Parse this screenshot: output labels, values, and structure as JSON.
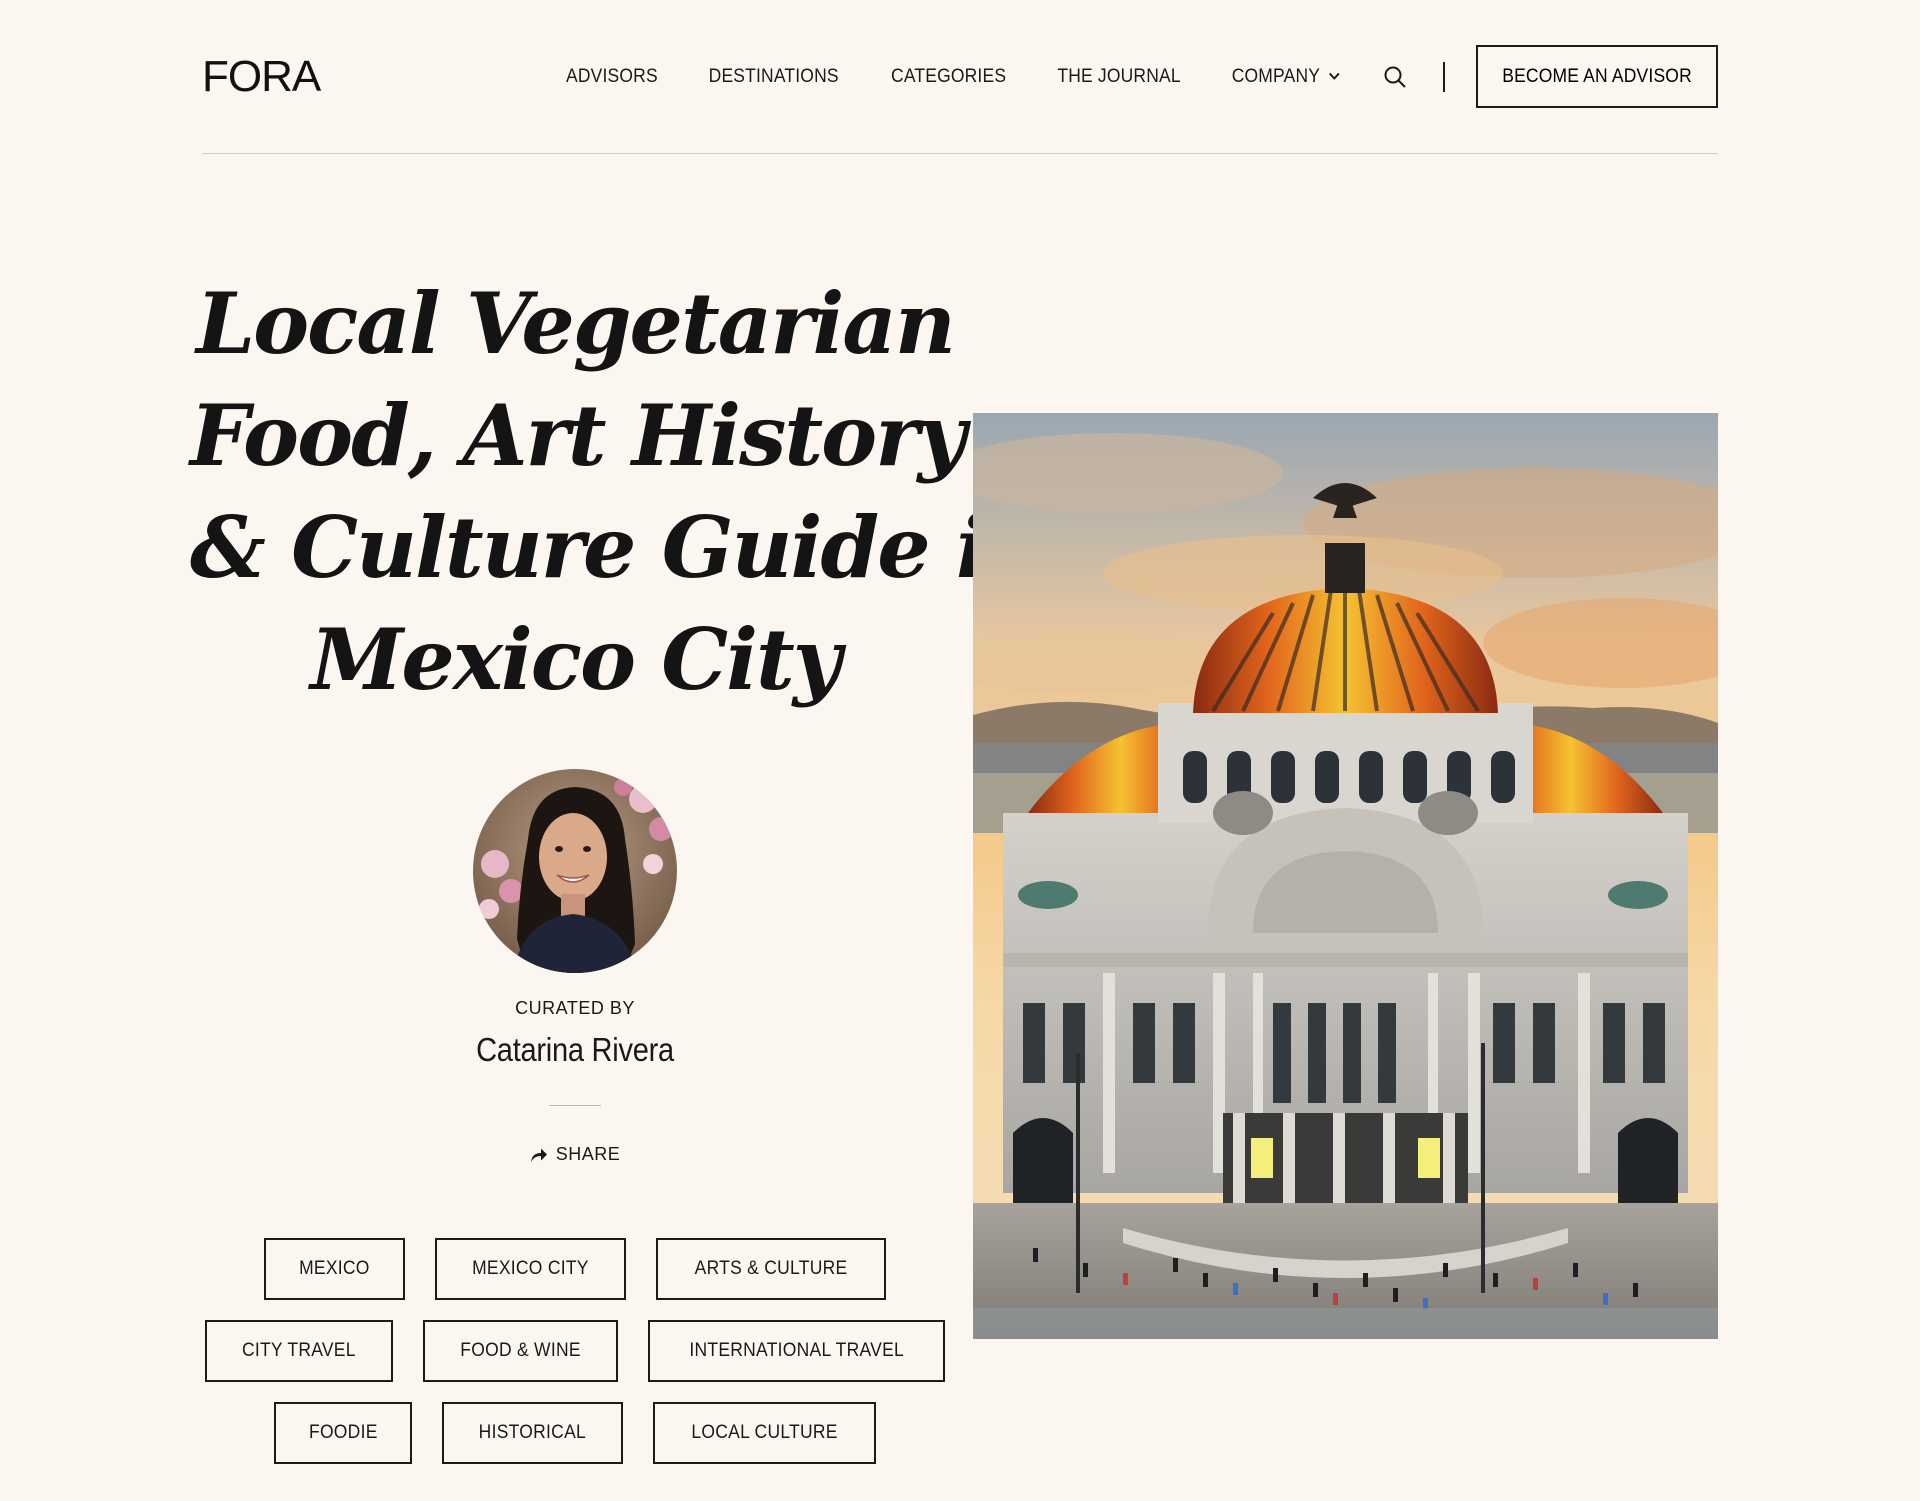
{
  "brand": {
    "logo": "FORA"
  },
  "nav": {
    "items": [
      {
        "label": "ADVISORS"
      },
      {
        "label": "DESTINATIONS"
      },
      {
        "label": "CATEGORIES"
      },
      {
        "label": "THE JOURNAL"
      },
      {
        "label": "COMPANY"
      }
    ],
    "search_icon": "search-icon",
    "cta_label": "BECOME AN ADVISOR"
  },
  "article": {
    "title_lines": [
      "Local Vegetarian",
      "Food, Art History",
      "& Culture Guide in",
      "Mexico City"
    ],
    "curated_label": "CURATED BY",
    "curator_name": "Catarina Rivera",
    "share_label": "SHARE"
  },
  "tags": {
    "rows": [
      [
        "MEXICO",
        "MEXICO CITY",
        "ARTS & CULTURE"
      ],
      [
        "CITY TRAVEL",
        "FOOD & WINE",
        "INTERNATIONAL TRAVEL"
      ],
      [
        "FOODIE",
        "HISTORICAL",
        "LOCAL CULTURE"
      ]
    ]
  },
  "colors": {
    "background": "#fbf6f0",
    "text": "#1a1a1a",
    "rule": "#cfcac4"
  }
}
